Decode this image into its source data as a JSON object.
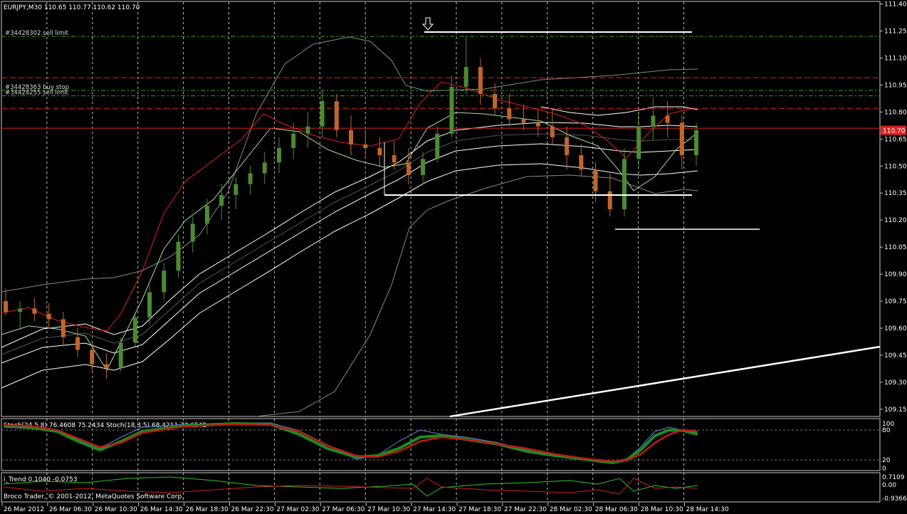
{
  "header": {
    "symbol_info": "EURJPY,M30  110.65 110.77 110.62 110.70",
    "copyright": "Broco Trader, © 2001-2012, MetaQuotes Software Corp."
  },
  "price_scale": {
    "ticks": [
      "111.40",
      "111.25",
      "111.10",
      "110.95",
      "110.80",
      "110.65",
      "110.50",
      "110.35",
      "110.20",
      "110.05",
      "109.90",
      "109.75",
      "109.60",
      "109.45",
      "109.30",
      "109.15"
    ],
    "current_price": "110.70",
    "ylim": [
      109.11,
      111.41
    ]
  },
  "time_axis": {
    "labels": [
      "26 Mar 2012",
      "26 Mar 06:30",
      "26 Mar 10:30",
      "26 Mar 14:30",
      "26 Mar 18:30",
      "26 Mar 22:30",
      "27 Mar 02:30",
      "27 Mar 06:30",
      "27 Mar 10:30",
      "27 Mar 14:30",
      "27 Mar 18:30",
      "27 Mar 22:30",
      "28 Mar 02:30",
      "28 Mar 06:30",
      "28 Mar 10:30",
      "28 Mar 14:30"
    ]
  },
  "orders": [
    {
      "label": "#34428302 sell limit",
      "price": 111.22,
      "color": "#33aa33"
    },
    {
      "label": "#34428363 buy stop",
      "price": 110.92,
      "color": "#33aa33"
    },
    {
      "label": "#34428255 sell limit",
      "price": 110.89,
      "color": "#33aa33"
    }
  ],
  "red_levels": [
    110.99,
    110.82,
    110.71
  ],
  "stoch_panel": {
    "label": "Stoch(24,5,8) 76.4608 75.2434  Stoch(18,3,5) 68.4211 72.6542",
    "ticks": [
      "100",
      "80",
      "20",
      "0"
    ]
  },
  "trend_panel": {
    "label": "i_Trend 0.1040 -0.0753",
    "ticks": [
      "0.7109",
      "0.00",
      "-0.9366"
    ]
  },
  "colors": {
    "bull": "#4d8a32",
    "bear": "#c0662c",
    "grid": "#c8c8c8",
    "red_line": "#e02020",
    "price_box": "#e02020"
  },
  "chart_data": {
    "type": "candlestick",
    "timeframe": "M30",
    "symbol": "EURJPY",
    "ylim": [
      109.11,
      111.41
    ],
    "candles": [
      [
        109.75,
        109.82,
        109.67,
        109.69
      ],
      [
        109.69,
        109.75,
        109.6,
        109.71
      ],
      [
        109.71,
        109.77,
        109.64,
        109.68
      ],
      [
        109.68,
        109.74,
        109.6,
        109.65
      ],
      [
        109.65,
        109.69,
        109.5,
        109.55
      ],
      [
        109.55,
        109.6,
        109.44,
        109.48
      ],
      [
        109.48,
        109.52,
        109.36,
        109.4
      ],
      [
        109.4,
        109.46,
        109.32,
        109.38
      ],
      [
        109.38,
        109.55,
        109.36,
        109.52
      ],
      [
        109.52,
        109.68,
        109.5,
        109.66
      ],
      [
        109.66,
        109.84,
        109.62,
        109.8
      ],
      [
        109.8,
        109.96,
        109.76,
        109.92
      ],
      [
        109.92,
        110.12,
        109.88,
        110.08
      ],
      [
        110.08,
        110.22,
        110.02,
        110.18
      ],
      [
        110.18,
        110.32,
        110.12,
        110.28
      ],
      [
        110.28,
        110.4,
        110.2,
        110.34
      ],
      [
        110.34,
        110.44,
        110.26,
        110.4
      ],
      [
        110.4,
        110.5,
        110.34,
        110.46
      ],
      [
        110.46,
        110.58,
        110.4,
        110.52
      ],
      [
        110.52,
        110.66,
        110.46,
        110.6
      ],
      [
        110.6,
        110.74,
        110.54,
        110.68
      ],
      [
        110.68,
        110.8,
        110.6,
        110.72
      ],
      [
        110.72,
        110.92,
        110.66,
        110.86
      ],
      [
        110.86,
        110.9,
        110.66,
        110.7
      ],
      [
        110.7,
        110.78,
        110.56,
        110.62
      ],
      [
        110.62,
        110.7,
        110.54,
        110.6
      ],
      [
        110.6,
        110.66,
        110.5,
        110.56
      ],
      [
        110.56,
        110.64,
        110.48,
        110.52
      ],
      [
        110.52,
        110.6,
        110.4,
        110.45
      ],
      [
        110.45,
        110.58,
        110.4,
        110.54
      ],
      [
        110.54,
        110.72,
        110.52,
        110.68
      ],
      [
        110.68,
        111.0,
        110.66,
        110.94
      ],
      [
        110.94,
        111.22,
        110.9,
        111.05
      ],
      [
        111.05,
        111.1,
        110.84,
        110.9
      ],
      [
        110.9,
        110.96,
        110.78,
        110.82
      ],
      [
        110.82,
        110.9,
        110.72,
        110.76
      ],
      [
        110.76,
        110.84,
        110.7,
        110.74
      ],
      [
        110.74,
        110.82,
        110.66,
        110.72
      ],
      [
        110.72,
        110.82,
        110.62,
        110.66
      ],
      [
        110.66,
        110.72,
        110.48,
        110.56
      ],
      [
        110.56,
        110.62,
        110.44,
        110.48
      ],
      [
        110.48,
        110.52,
        110.3,
        110.36
      ],
      [
        110.36,
        110.46,
        110.22,
        110.26
      ],
      [
        110.26,
        110.6,
        110.22,
        110.54
      ],
      [
        110.54,
        110.8,
        110.5,
        110.72
      ],
      [
        110.72,
        110.88,
        110.64,
        110.78
      ],
      [
        110.78,
        110.86,
        110.66,
        110.74
      ],
      [
        110.74,
        110.78,
        110.48,
        110.56
      ],
      [
        110.56,
        110.74,
        110.5,
        110.7
      ]
    ]
  }
}
